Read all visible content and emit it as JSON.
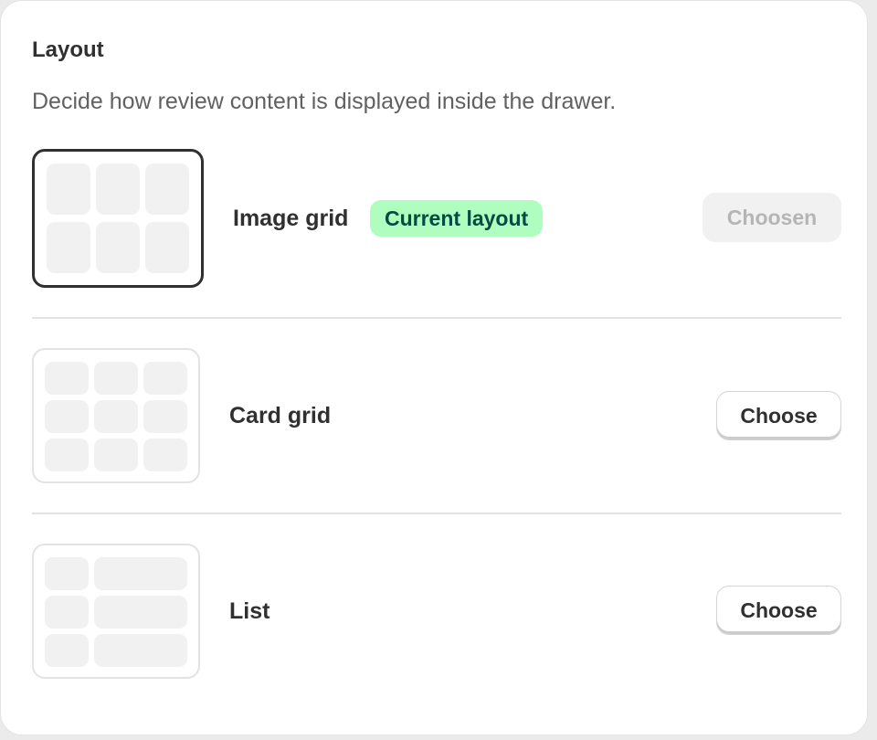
{
  "section": {
    "title": "Layout",
    "description": "Decide how review content is displayed inside the drawer."
  },
  "options": [
    {
      "name": "Image grid",
      "badge": "Current layout",
      "button_label": "Choosen",
      "selected": true
    },
    {
      "name": "Card grid",
      "button_label": "Choose",
      "selected": false
    },
    {
      "name": "List",
      "button_label": "Choose",
      "selected": false
    }
  ],
  "colors": {
    "text_primary": "#303030",
    "text_secondary": "#616161",
    "badge_bg": "#affebf",
    "badge_text": "#014b40",
    "selected_border": "#303030",
    "placeholder_fill": "#f1f1f1"
  }
}
